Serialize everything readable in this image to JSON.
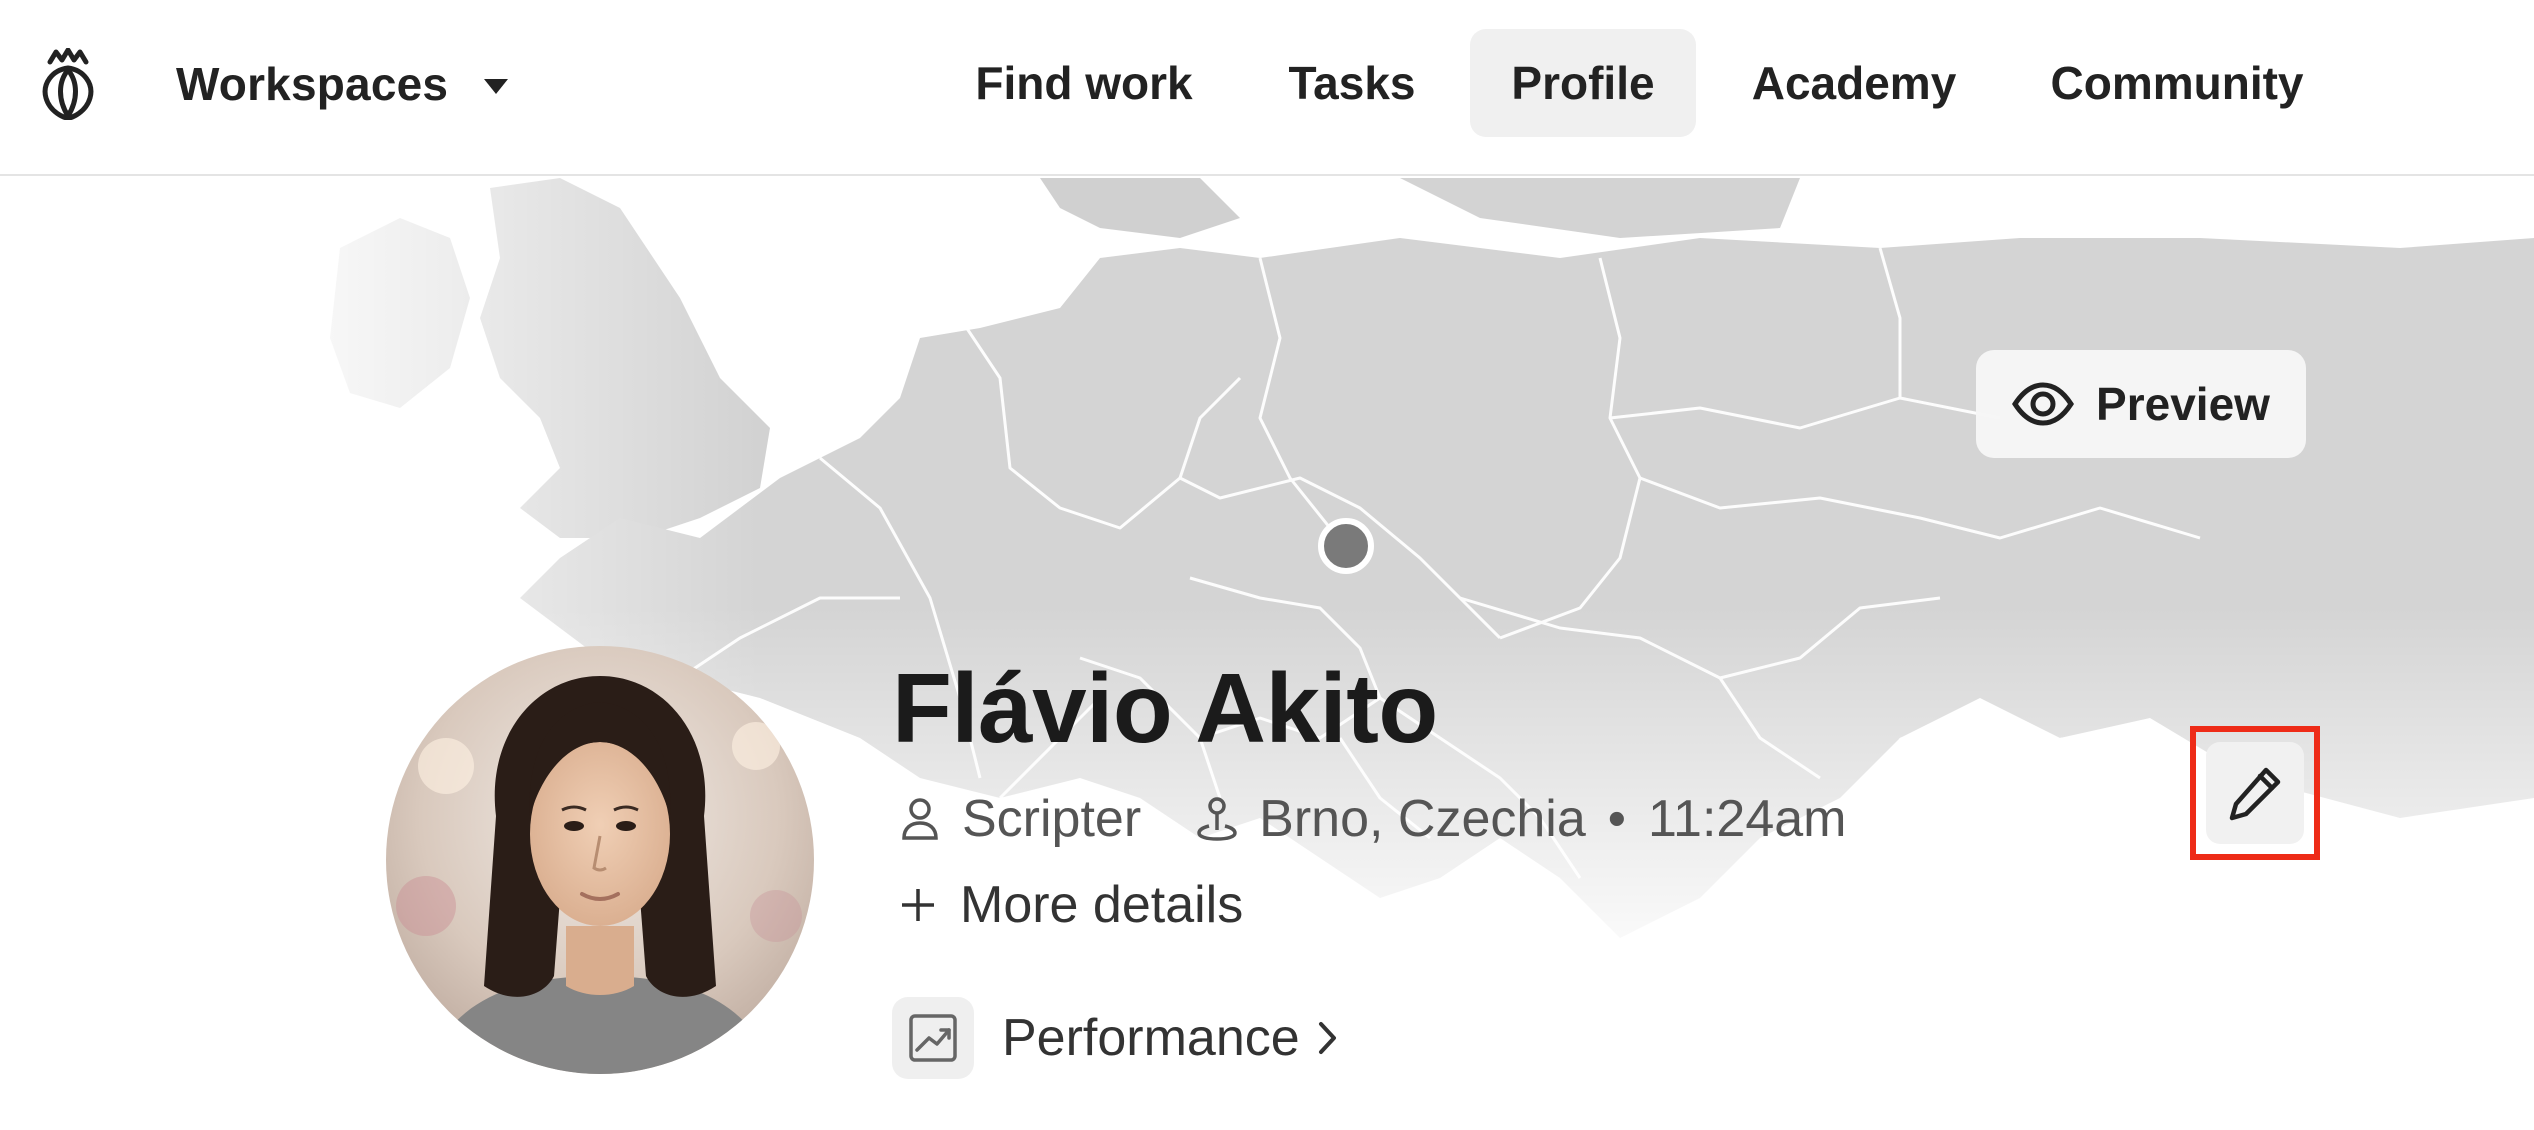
{
  "header": {
    "logo_icon": "crowned-rose-logo-icon",
    "workspaces_label": "Workspaces",
    "nav": [
      {
        "label": "Find work",
        "active": false
      },
      {
        "label": "Tasks",
        "active": false
      },
      {
        "label": "Profile",
        "active": true
      },
      {
        "label": "Academy",
        "active": false
      },
      {
        "label": "Community",
        "active": false
      }
    ]
  },
  "banner": {
    "background": "map-of-europe",
    "location_pin_color": "#7a7a7a",
    "preview_label": "Preview",
    "preview_icon": "eye-icon",
    "edit_icon": "pencil-icon",
    "edit_highlight_color": "#ee2b17"
  },
  "profile": {
    "name": "Flávio Akito",
    "role": "Scripter",
    "location": "Brno, Czechia",
    "separator": "•",
    "local_time": "11:24am",
    "more_details_label": "More details",
    "performance_label": "Performance"
  }
}
